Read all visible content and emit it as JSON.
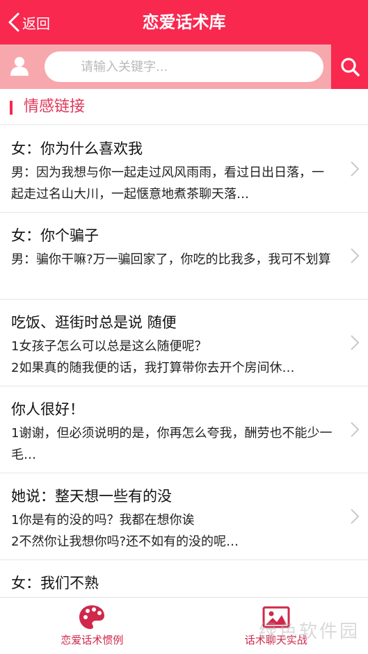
{
  "header": {
    "back_label": "返回",
    "title": "恋爱话术库"
  },
  "search": {
    "placeholder": "请输入关键字..."
  },
  "section": {
    "title": "情感链接"
  },
  "items": [
    {
      "title": "女：你为什么喜欢我",
      "body": "男：因为我想与你一起走过风风雨雨，看过日出日落，一起走过名山大川，一起惬意地煮茶聊天落…"
    },
    {
      "title": "女：你个骗子",
      "body": "男：骗你干嘛?万一骗回家了，你吃的比我多，我可不划算"
    },
    {
      "title": "吃饭、逛街时总是说 随便",
      "body": "1女孩子怎么可以总是这么随便呢？\n2如果真的随我便的话，我打算带你去开个房间休…"
    },
    {
      "title": "你人很好！",
      "body": "1谢谢，但必须说明的是，你再怎么夸我，酬劳也不能少一毛…"
    },
    {
      "title": "她说：整天想一些有的没",
      "body": "1你是有的没的吗？我都在想你诶\n2不然你让我想你吗?还不如有的没的呢…"
    },
    {
      "title": "女：我们不熟",
      "body": ""
    }
  ],
  "nav": {
    "tab1_label": "恋爱话术惯例",
    "tab2_label": "话术聊天实战"
  },
  "watermark": "绿色软件园",
  "colors": {
    "primary": "#f8284f",
    "search_bg": "#f7a8ad",
    "accent_text": "#d0284a"
  }
}
